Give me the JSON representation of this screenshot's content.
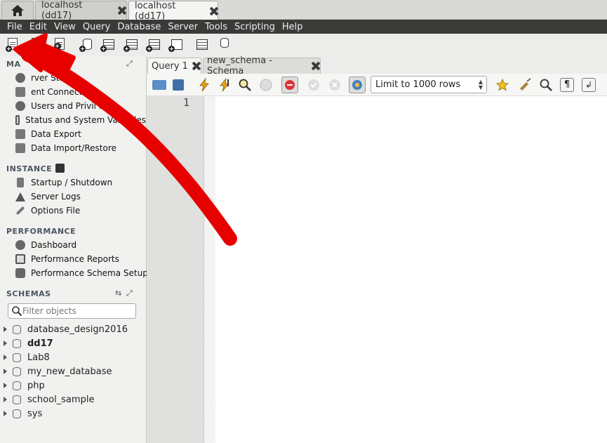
{
  "window_tabs": [
    {
      "label": ""
    },
    {
      "label": "localhost (dd17)"
    },
    {
      "label": "localhost (dd17)"
    }
  ],
  "menu": [
    "File",
    "Edit",
    "View",
    "Query",
    "Database",
    "Server",
    "Tools",
    "Scripting",
    "Help"
  ],
  "sidebar": {
    "management": {
      "title": "MA",
      "items": [
        "rver Status",
        "ent Connections",
        "Users and Privil  es",
        "Status and System Variables",
        "Data Export",
        "Data Import/Restore"
      ]
    },
    "instance": {
      "title": "INSTANCE",
      "items": [
        "Startup / Shutdown",
        "Server Logs",
        "Options File"
      ]
    },
    "performance": {
      "title": "PERFORMANCE",
      "items": [
        "Dashboard",
        "Performance Reports",
        "Performance Schema Setup"
      ]
    },
    "schemas": {
      "title": "SCHEMAS",
      "filter_placeholder": "Filter objects",
      "items": [
        "database_design2016",
        "dd17",
        "Lab8",
        "my_new_database",
        "php",
        "school_sample",
        "sys"
      ],
      "default_schema": "dd17"
    }
  },
  "query_tabs": [
    {
      "label": "Query 1"
    },
    {
      "label": "new_schema - Schema"
    }
  ],
  "query_toolbar": {
    "limit": "Limit to 1000 rows"
  },
  "editor": {
    "line_numbers": [
      "1"
    ]
  },
  "annotation": {
    "color": "#e60000"
  }
}
